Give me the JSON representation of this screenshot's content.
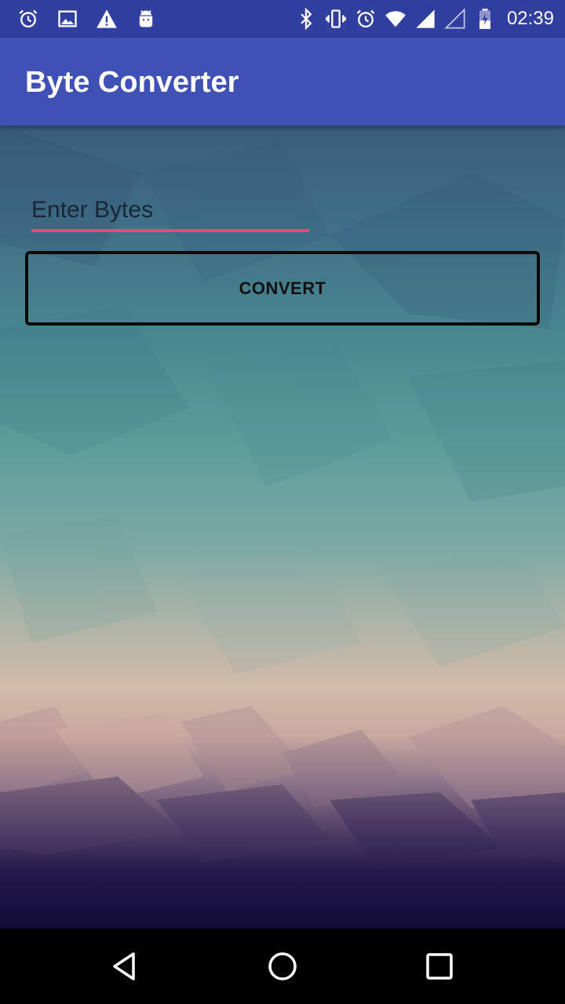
{
  "status_bar": {
    "time": "02:39",
    "left_icons": [
      "alarm-icon",
      "image-icon",
      "warning-icon",
      "android-icon"
    ],
    "right_icons": [
      "bluetooth-icon",
      "vibrate-icon",
      "alarm-icon",
      "wifi-icon",
      "signal-icon",
      "signal-empty-icon",
      "battery-icon"
    ]
  },
  "app_bar": {
    "title": "Byte Converter"
  },
  "form": {
    "bytes_placeholder": "Enter Bytes",
    "bytes_value": "",
    "convert_label": "CONVERT"
  },
  "nav_bar": {
    "buttons": [
      "back-icon",
      "home-icon",
      "recents-icon"
    ]
  },
  "colors": {
    "status_bar": "#303f9f",
    "app_bar": "#3f51b5",
    "input_underline": "#e8487a"
  }
}
